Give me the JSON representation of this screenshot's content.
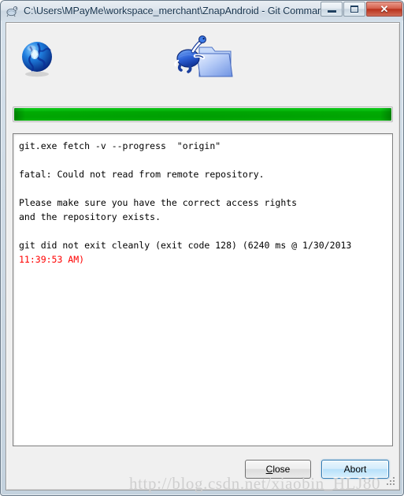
{
  "window": {
    "title": "C:\\Users\\MPayMe\\workspace_merchant\\ZnapAndroid - Git Comman...",
    "title_icon": "tortoisegit-turtle-icon",
    "caption": {
      "minimize_label": "Minimize",
      "maximize_label": "Restore",
      "close_label": "✕"
    }
  },
  "icons": {
    "globe": "blue-globe-icon",
    "turtle_folder": "turtle-pushing-folder-icon"
  },
  "progress": {
    "percent": 100,
    "color": "#12cc22"
  },
  "log": {
    "lines": [
      {
        "text": "git.exe fetch -v --progress  \"origin\"",
        "error": false
      },
      {
        "text": "",
        "error": false
      },
      {
        "text": "fatal: Could not read from remote repository.",
        "error": false
      },
      {
        "text": "",
        "error": false
      },
      {
        "text": "Please make sure you have the correct access rights",
        "error": false
      },
      {
        "text": "and the repository exists.",
        "error": false
      },
      {
        "text": "",
        "error": false
      },
      {
        "text": "git did not exit cleanly (exit code 128) (6240 ms @ 1/30/2013",
        "error": false
      },
      {
        "text": "11:39:53 AM)",
        "error": true
      }
    ]
  },
  "buttons": {
    "close": {
      "label": "Close",
      "accel": "C"
    },
    "abort": {
      "label": "Abort"
    }
  },
  "watermark": {
    "text": "http://blog.csdn.net/xiaobin_HLJ80"
  }
}
